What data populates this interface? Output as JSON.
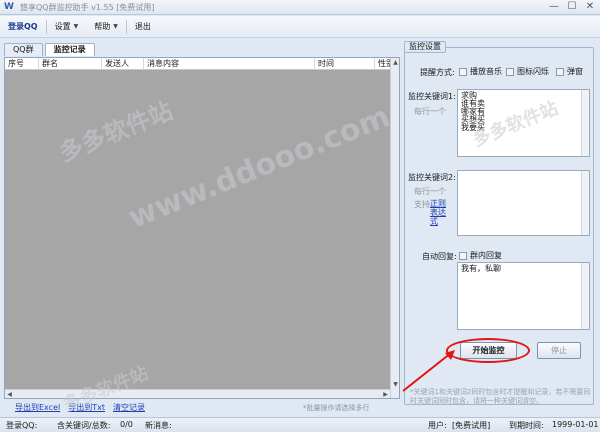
{
  "window": {
    "title": "悠享QQ群监控助手 v1.55 [免费试用]",
    "controls": [
      "—",
      "☐",
      "✕"
    ]
  },
  "toolbar": {
    "login": "登录QQ",
    "settings": "设置",
    "help": "帮助",
    "exit": "退出"
  },
  "tabs": [
    {
      "label": "QQ群"
    },
    {
      "label": "监控记录"
    }
  ],
  "table": {
    "columns": [
      "序号",
      "群名",
      "发送人",
      "消息内容",
      "时间",
      "性别"
    ]
  },
  "bottom_links": {
    "export_excel": "导出到Excel",
    "export_txt": "导出到Txt",
    "clear": "清空记录",
    "hint": "*批量操作请选择多行"
  },
  "settings": {
    "legend": "监控设置",
    "remind_label": "提醒方式:",
    "remind_options": [
      "播放音乐",
      "图标闪烁",
      "弹窗"
    ],
    "kw1_label": "监控关键词1:",
    "kw1_sub": "每行一个",
    "kw1_value": "求购\n谁有卖\n哪家有\n买想买\n我要买",
    "kw2_label": "监控关键词2:",
    "kw2_sub1": "每行一个",
    "kw2_sub2": "支持",
    "kw2_link": "正则表达式",
    "kw2_value": "",
    "auto_reply_label": "自动回复:",
    "auto_reply_option": "群内回复",
    "auto_reply_value": "我有，私聊",
    "start_button": "开始监控",
    "stop_button": "停止",
    "notice": "*关键词1和关键词2同时包含时才提醒和记录，若不需要同时关键词同时包含，请将一种关键词清空。"
  },
  "status": {
    "login_qq": "登录QQ:",
    "kw_total": "含关键词/总数:",
    "kw_total_value": "0/0",
    "new_msg": "新消息:",
    "user_label": "用户:",
    "user_value": "[免费试用]",
    "expire_label": "到期时间:",
    "expire_value": "1999-01-01"
  },
  "watermark": {
    "text1": "多多软件站",
    "text2": "www.ddooo.com"
  },
  "colors": {
    "highlight": "#e01515",
    "link": "#1f3fb0",
    "table_bg": "#a6a6a6"
  }
}
